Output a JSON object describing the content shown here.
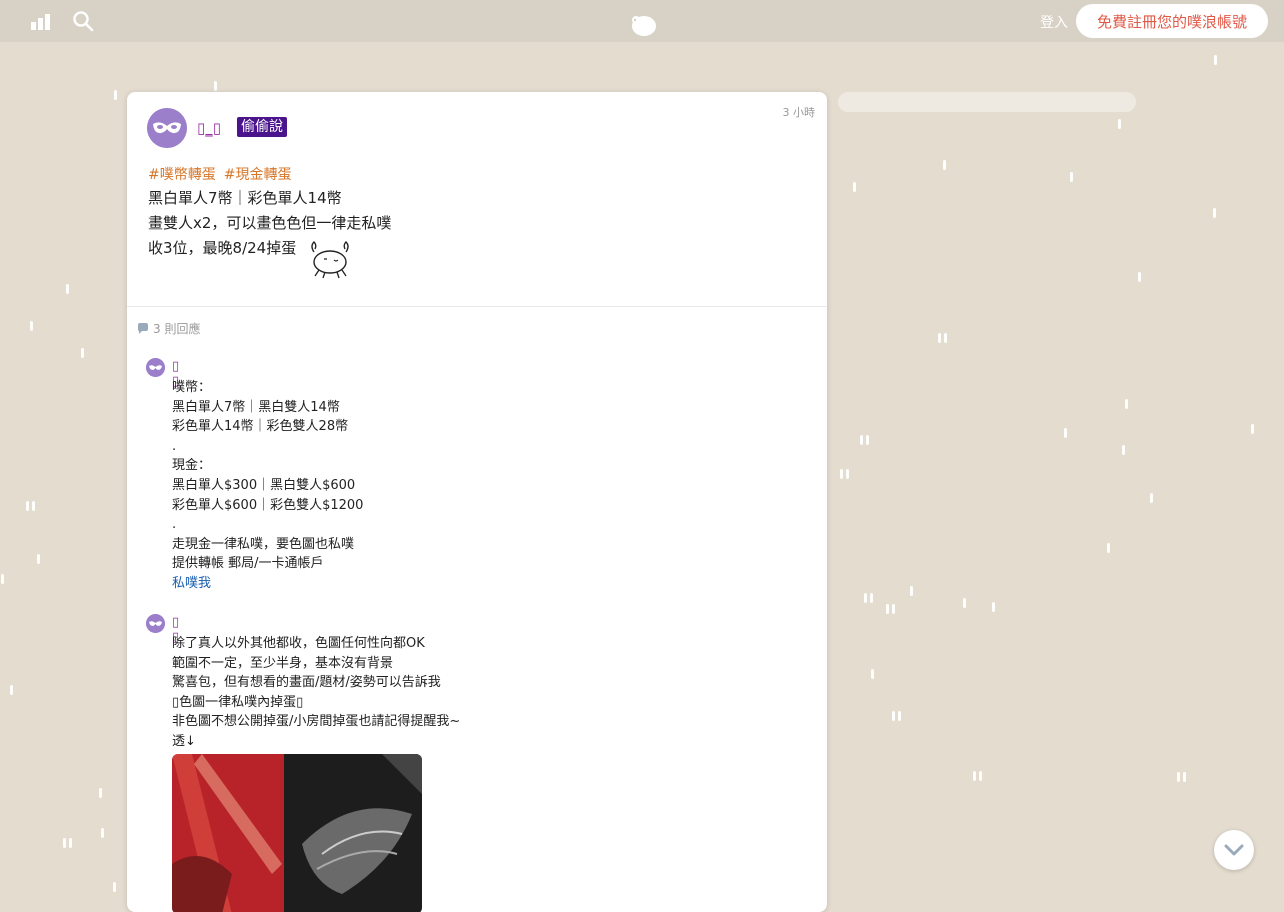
{
  "topbar": {
    "login_label": "登入",
    "signup_label": "免費註冊您的噗浪帳號",
    "icons": [
      "timeline-icon",
      "search-icon",
      "plurk-logo-icon"
    ]
  },
  "post": {
    "author": "▯_▯",
    "badge": "偷偷說",
    "time": "3 小時",
    "tags": [
      "#噗幣轉蛋",
      "#現金轉蛋"
    ],
    "lines": [
      "黑白單人7幣｜彩色單人14幣",
      "畫雙人x2，可以畫色色但一律走私噗",
      "收3位，最晚8/24掉蛋"
    ]
  },
  "responses": {
    "count_label": "3 則回應",
    "items": [
      {
        "author": "▯ ▯",
        "lines": [
          "噗幣：",
          "黑白單人7幣｜黑白雙人14幣",
          "彩色單人14幣｜彩色雙人28幣",
          ".",
          "現金：",
          "黑白單人$300｜黑白雙人$600",
          "彩色單人$600｜彩色雙人$1200",
          ".",
          "走現金一律私噗，要色圖也私噗",
          "提供轉帳 郵局/一卡通帳戶"
        ],
        "link": "私噗我"
      },
      {
        "author": "▯ ▯",
        "lines": [
          "除了真人以外其他都收，色圖任何性向都OK",
          "範圍不一定，至少半身，基本沒有背景",
          "驚喜包，但有想看的畫面/題材/姿勢可以告訴我",
          "▯色圖一律私噗內掉蛋▯",
          "非色圖不想公開掉蛋/小房間掉蛋也請記得提醒我~",
          "透↓"
        ]
      }
    ]
  },
  "colors": {
    "background": "#e4dccf",
    "topbar": "#d8d2c6",
    "accent_red": "#e05a47",
    "author_purple": "#9b30a6",
    "badge_bg": "#4a148c",
    "tag_orange": "#d6762a",
    "link_blue": "#1a5fb4"
  }
}
